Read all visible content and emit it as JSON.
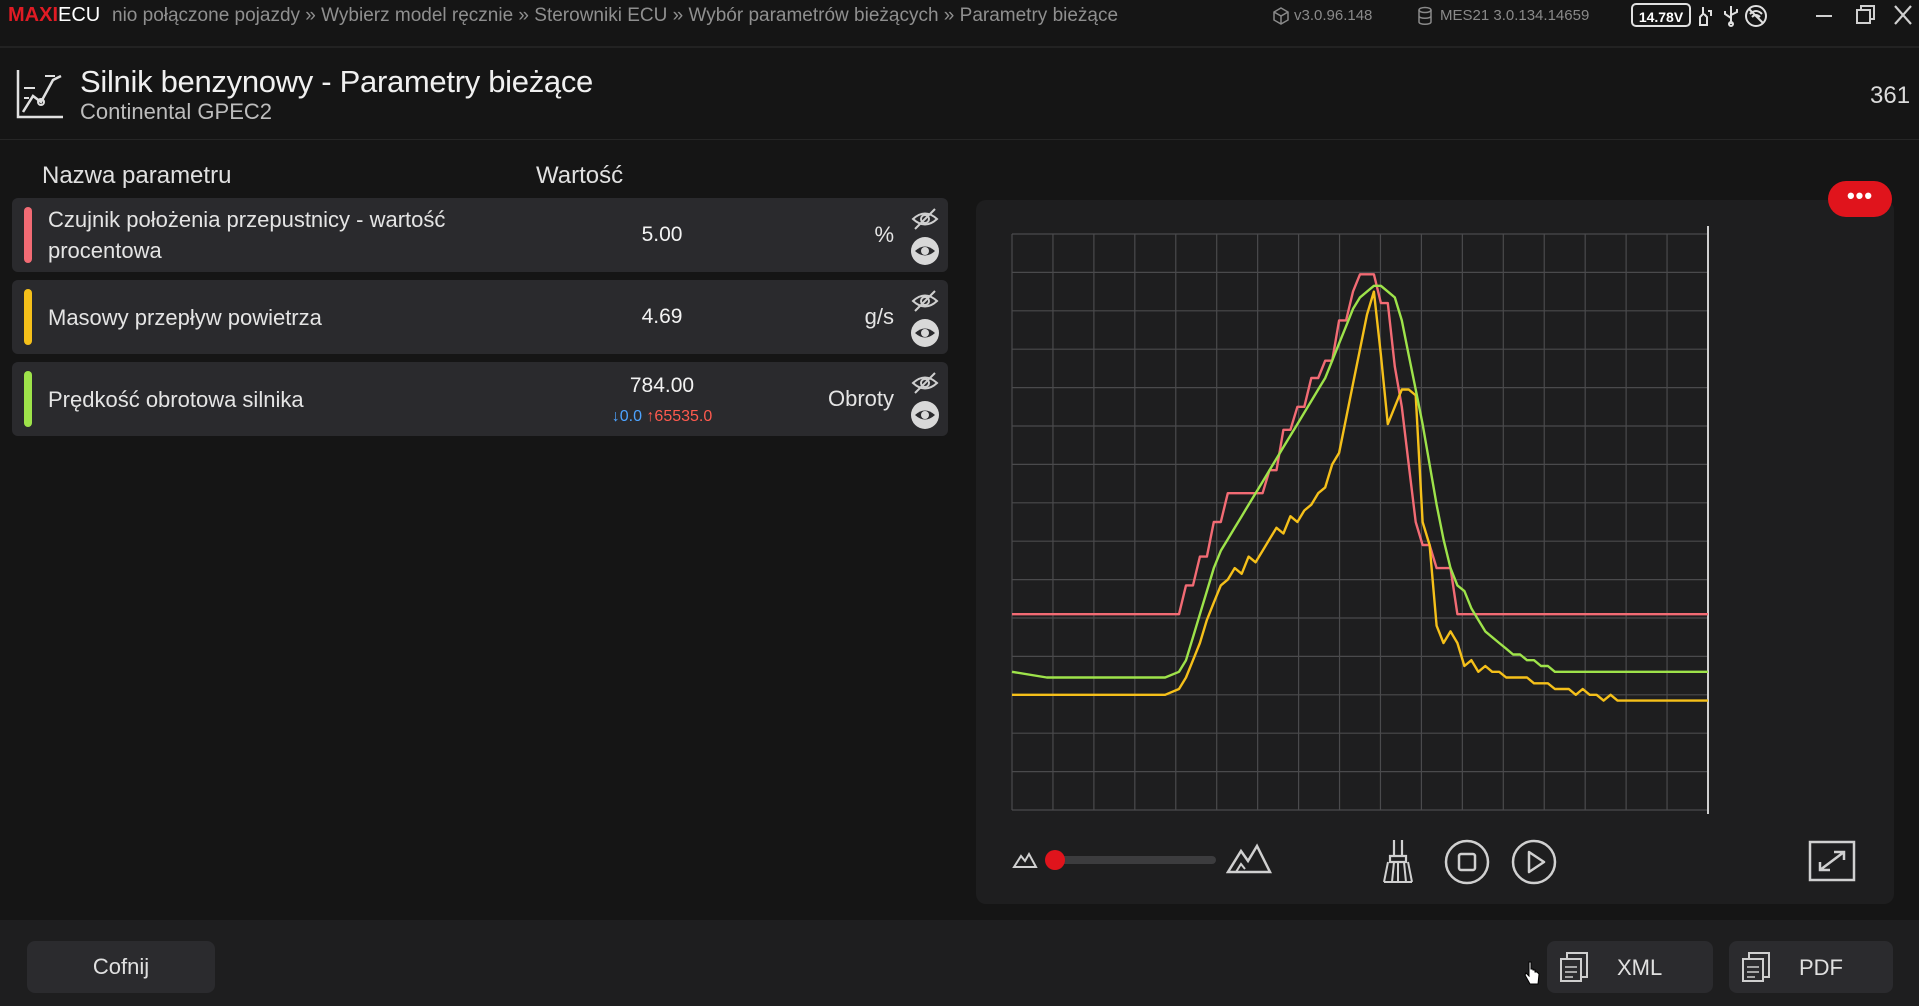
{
  "topbar": {
    "brand_maxi": "MAXI",
    "brand_ecu": "ECU",
    "breadcrumb": "nio połączone pojazdy » Wybierz model ręcznie » Sterowniki ECU » Wybór parametrów bieżących » Parametry bieżące",
    "app_version": "v3.0.96.148",
    "db_version": "MES21 3.0.134.14659",
    "voltage": "14.78V"
  },
  "header": {
    "title": "Silnik benzynowy - Parametry bieżące",
    "subtitle": "Continental GPEC2",
    "counter": "361"
  },
  "table": {
    "col_name": "Nazwa parametru",
    "col_value": "Wartość",
    "rows": [
      {
        "name_line1": "Czujnik położenia przepustnicy - wartość",
        "name_line2": "procentowa",
        "value": "5.00",
        "unit": "%",
        "color": "#f26b74"
      },
      {
        "name_line1": "Masowy przepływ powietrza",
        "value": "4.69",
        "unit": "g/s",
        "color": "#f5c01a"
      },
      {
        "name_line1": "Prędkość obrotowa silnika",
        "value": "784.00",
        "unit": "Obroty",
        "min": "↓0.0",
        "max": "↑65535.0",
        "color": "#9ee34a"
      }
    ]
  },
  "chart": {
    "more_label": "•••",
    "zoom_level": 0.0
  },
  "bottom": {
    "back_label": "Cofnij",
    "xml_label": "XML",
    "pdf_label": "PDF"
  },
  "chart_data": {
    "type": "line",
    "title": "",
    "xlabel": "",
    "ylabel": "",
    "grid": true,
    "xlim": [
      0,
      100
    ],
    "ylim": [
      0,
      100
    ],
    "x": [
      0,
      5,
      10,
      15,
      20,
      22,
      24,
      25,
      26,
      27,
      28,
      29,
      30,
      31,
      32,
      33,
      34,
      35,
      36,
      37,
      38,
      39,
      40,
      41,
      42,
      43,
      44,
      45,
      46,
      47,
      48,
      49,
      50,
      51,
      52,
      53,
      54,
      55,
      56,
      57,
      58,
      59,
      60,
      61,
      62,
      63,
      64,
      65,
      66,
      67,
      68,
      69,
      70,
      71,
      72,
      73,
      74,
      75,
      76,
      77,
      78,
      79,
      80,
      81,
      82,
      83,
      84,
      85,
      86,
      87,
      88,
      89,
      90,
      91,
      92,
      93,
      94,
      95,
      96,
      97,
      98,
      99,
      100
    ],
    "series": [
      {
        "color": "#f26b74",
        "values": [
          34,
          34,
          34,
          34,
          34,
          34,
          34,
          39,
          39,
          44,
          44,
          50,
          50,
          55,
          55,
          55,
          55,
          55,
          55,
          59,
          59,
          66,
          66,
          70,
          70,
          75,
          75,
          78,
          78,
          85,
          85,
          90,
          93,
          93,
          93,
          88,
          88,
          77,
          70,
          60,
          50,
          46,
          46,
          42,
          42,
          42,
          34,
          34,
          34,
          34,
          34,
          34,
          34,
          34,
          34,
          34,
          34,
          34,
          34,
          34,
          34,
          34,
          34,
          34,
          34,
          34,
          34,
          34,
          34,
          34,
          34,
          34,
          34,
          34,
          34,
          34,
          34,
          34,
          34,
          34,
          34,
          34,
          34
        ]
      },
      {
        "color": "#f5c01a",
        "values": [
          20,
          20,
          20,
          20,
          20,
          20,
          21,
          23,
          26,
          29,
          33,
          36,
          39,
          40,
          42,
          41,
          44,
          43,
          45,
          47,
          49,
          48,
          51,
          50,
          52,
          53,
          55,
          56,
          60,
          62,
          68,
          74,
          80,
          86,
          90,
          79,
          67,
          70,
          73,
          73,
          72,
          50,
          46,
          32,
          29,
          31,
          29,
          25,
          26,
          24,
          25,
          24,
          24,
          23,
          23,
          23,
          23,
          22,
          22,
          22,
          21,
          21,
          21,
          20,
          21,
          20,
          20,
          19,
          20,
          19,
          19,
          19,
          19,
          19,
          19,
          19,
          19,
          19,
          19,
          19,
          19,
          19,
          19
        ]
      },
      {
        "color": "#9ee34a",
        "values": [
          24,
          23,
          23,
          23,
          23,
          23,
          24,
          26,
          30,
          34,
          38,
          42,
          45,
          47,
          49,
          51,
          53,
          55,
          57,
          59,
          61,
          63,
          65,
          67,
          69,
          71,
          73,
          75,
          78,
          81,
          84,
          87,
          89,
          90,
          91,
          91,
          90,
          89,
          85,
          79,
          73,
          67,
          60,
          53,
          47,
          42,
          39,
          38,
          35,
          33,
          31,
          30,
          29,
          28,
          27,
          27,
          26,
          26,
          25,
          25,
          24,
          24,
          24,
          24,
          24,
          24,
          24,
          24,
          24,
          24,
          24,
          24,
          24,
          24,
          24,
          24,
          24,
          24,
          24,
          24,
          24,
          24,
          24
        ]
      }
    ]
  }
}
